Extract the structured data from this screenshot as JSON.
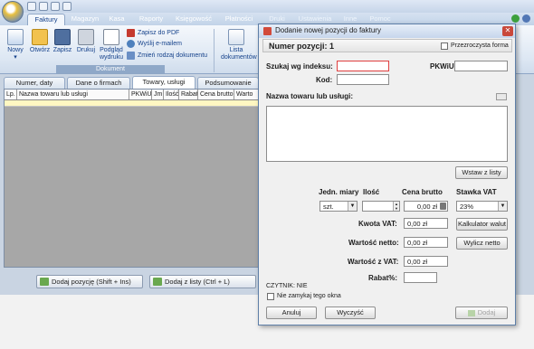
{
  "menu": {
    "tabs": [
      "Faktury",
      "Magazyn",
      "Kasa",
      "Raporty",
      "Księgowość",
      "Płatności",
      "Druki",
      "Ustawienia",
      "Inne",
      "Pomoc"
    ],
    "active": "Faktury"
  },
  "ribbon": {
    "new_label": "Nowy",
    "open_label": "Otwórz",
    "save_label": "Zapisz",
    "print_label": "Drukuj",
    "preview_label": "Podgląd wydruku",
    "pdf_label": "Zapisz do PDF",
    "email_label": "Wyślij e-mailem",
    "change_type_label": "Zmień rodzaj dokumentu",
    "group_label": "Dokument",
    "doc_list_label": "Lista dokumentów"
  },
  "doc_tabs": [
    "Numer, daty",
    "Dane o firmach",
    "Towary, usługi",
    "Podsumowanie"
  ],
  "doc_tab_active": "Towary, usługi",
  "table": {
    "columns": [
      "Lp.",
      "Nazwa towaru lub usługi",
      "PKWiU",
      "Jm",
      "Ilość",
      "Rabat",
      "Cena brutto",
      "Warto"
    ]
  },
  "bottom": {
    "add_position_label": "Dodaj pozycję (Shift + Ins)",
    "add_from_list_label": "Dodaj z listy (Ctrl + L)"
  },
  "dialog": {
    "title": "Dodanie nowej pozycji do faktury",
    "position_label": "Numer pozycji:",
    "position_number": "1",
    "transparent_label": "Przezroczysta forma",
    "search_index_label": "Szukaj wg indeksu:",
    "search_index_value": "",
    "pkwiu_label": "PKWiU:",
    "pkwiu_value": "",
    "code_label": "Kod:",
    "code_value": "",
    "name_label": "Nazwa towaru lub usługi:",
    "name_value": "",
    "insert_from_list_label": "Wstaw z listy",
    "unit_label": "Jedn. miary",
    "unit_value": "szt.",
    "qty_label": "Ilość",
    "qty_value": "",
    "gross_price_label": "Cena brutto",
    "gross_price_value": "0,00 zł",
    "vat_rate_label": "Stawka VAT",
    "vat_rate_value": "23%",
    "vat_amount_label": "Kwota VAT:",
    "vat_amount_value": "0,00 zł",
    "calculator_label": "Kalkulator walut",
    "net_value_label": "Wartość netto:",
    "net_value_value": "0,00 zł",
    "calc_net_label": "Wylicz netto",
    "gross_value_label": "Wartość z VAT:",
    "gross_value_value": "0,00 zł",
    "discount_label": "Rabat%:",
    "discount_value": "",
    "reader_label": "CZYTNIK: NIE",
    "keep_open_label": "Nie zamykaj tego okna",
    "cancel_label": "Anuluj",
    "clear_label": "Wyczyść",
    "add_label": "Dodaj"
  }
}
